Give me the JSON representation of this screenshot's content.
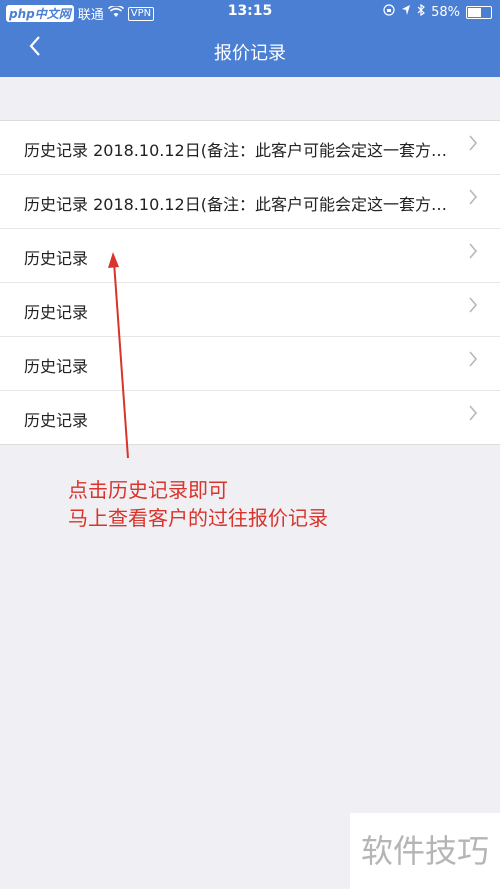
{
  "status_bar": {
    "logo": "php中文网",
    "carrier": "联通",
    "vpn": "VPN",
    "time": "13:15",
    "battery": "58%",
    "battery_level": 0.58
  },
  "nav": {
    "back_icon": "chevron-left-icon",
    "title": "报价记录"
  },
  "records": [
    {
      "label": "历史记录 2018.10.12日(备注：此客户可能会定这一套方…"
    },
    {
      "label": "历史记录 2018.10.12日(备注：此客户可能会定这一套方…"
    },
    {
      "label": "历史记录"
    },
    {
      "label": "历史记录"
    },
    {
      "label": "历史记录"
    },
    {
      "label": "历史记录"
    }
  ],
  "annotation": {
    "line1": "点击历史记录即可",
    "line2": "马上查看客户的过往报价记录",
    "color": "#d9342b"
  },
  "watermark": "软件技巧"
}
